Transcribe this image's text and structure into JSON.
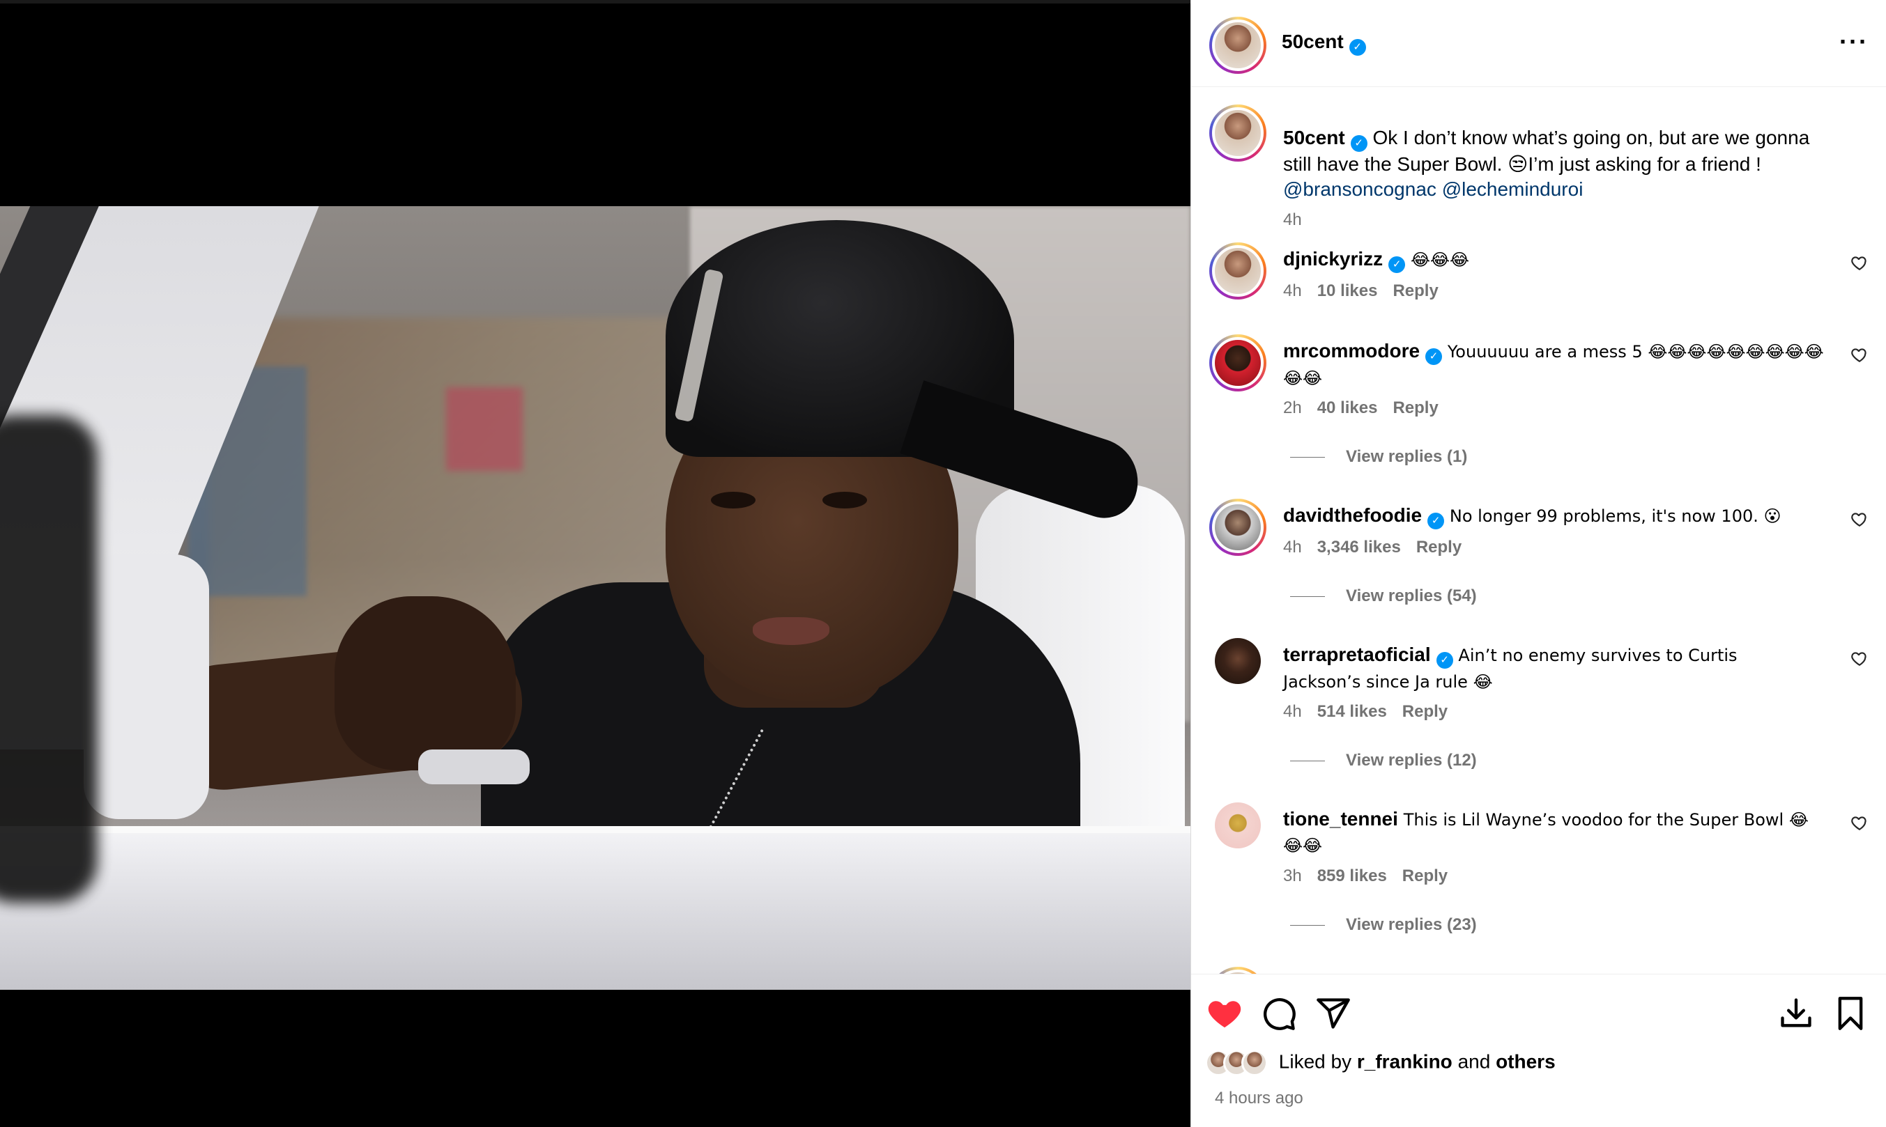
{
  "post": {
    "username": "50cent",
    "verified_mark": "✓",
    "caption": "Ok I don’t know what’s going on, but are we gonna still have the Super Bowl. 😒I’m just asking for a friend !",
    "mentions": [
      "@bransoncognac",
      "@lecheminduroi"
    ],
    "time": "4h"
  },
  "comments": [
    {
      "username": "djnickyrizz",
      "verified": true,
      "text": "😂😂😂",
      "time": "4h",
      "likes": "10 likes",
      "reply": "Reply",
      "replies": ""
    },
    {
      "username": "mrcommodore",
      "verified": true,
      "text": "Youuuuuu are a mess 5 😂😂😂😂😂😂😂😂😂😂😂",
      "time": "2h",
      "likes": "40 likes",
      "reply": "Reply",
      "replies": "View replies (1)"
    },
    {
      "username": "davidthefoodie",
      "verified": true,
      "text": "No longer 99 problems, it's now 100. 😮",
      "time": "4h",
      "likes": "3,346 likes",
      "reply": "Reply",
      "replies": "View replies (54)"
    },
    {
      "username": "terrapretaoficial",
      "verified": true,
      "text": "Ain’t no enemy survives to Curtis Jackson’s since Ja rule 😂",
      "time": "4h",
      "likes": "514 likes",
      "reply": "Reply",
      "replies": "View replies (12)"
    },
    {
      "username": "tione_tennei",
      "verified": false,
      "text": "This is Lil Wayne’s voodoo for the Super Bowl 😂😂😂",
      "time": "3h",
      "likes": "859 likes",
      "reply": "Reply",
      "replies": "View replies (23)"
    }
  ],
  "actions": {
    "like_icon": "heart-filled-icon",
    "comment_icon": "comment-icon",
    "share_icon": "send-icon",
    "download_icon": "download-icon",
    "save_icon": "bookmark-icon",
    "liked_by_prefix": "Liked by",
    "liked_by_user": "r_frankino",
    "liked_by_and": "and",
    "liked_by_others": "others",
    "posted_ago": "4 hours ago"
  },
  "colors": {
    "like_red": "#ff3040",
    "verified_blue": "#0095f6",
    "muted_text": "#737373",
    "mention": "#00376b"
  }
}
